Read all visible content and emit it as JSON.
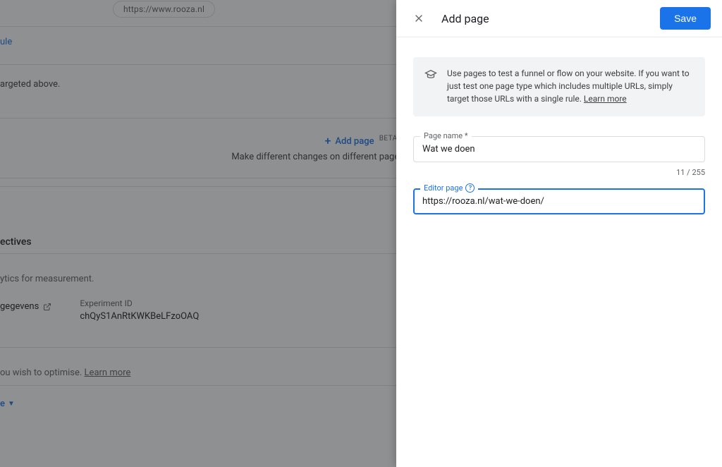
{
  "background": {
    "url_pill": "https://www.rooza.nl",
    "add_rule_link": "ule",
    "targeted_text": "argeted above.",
    "add_page_label": "Add page",
    "add_page_beta": "BETA",
    "add_page_desc": "Make different changes on different pages, e.g. a flow or funnel.",
    "objectives_heading": "ectives",
    "measurement_text": "ytics for measurement.",
    "gegevens_label": "gegevens",
    "experiment_id_label": "Experiment ID",
    "experiment_id_value": "chQyS1AnRtKWKBeLFzoOAQ",
    "optimise_text": "ou wish to optimise.  ",
    "learn_more": "Learn more",
    "add_objective_label": "e"
  },
  "panel": {
    "title": "Add page",
    "save_label": "Save",
    "info_text": "Use pages to test a funnel or flow on your website. If you want to just test one page type which includes multiple URLs, simply target those URLs with a single rule. ",
    "info_learn_more": "Learn more",
    "page_name": {
      "label": "Page name *",
      "value": "Wat we doen",
      "count": "11 / 255"
    },
    "editor_page": {
      "label": "Editor page",
      "value": "https://rooza.nl/wat-we-doen/"
    }
  }
}
